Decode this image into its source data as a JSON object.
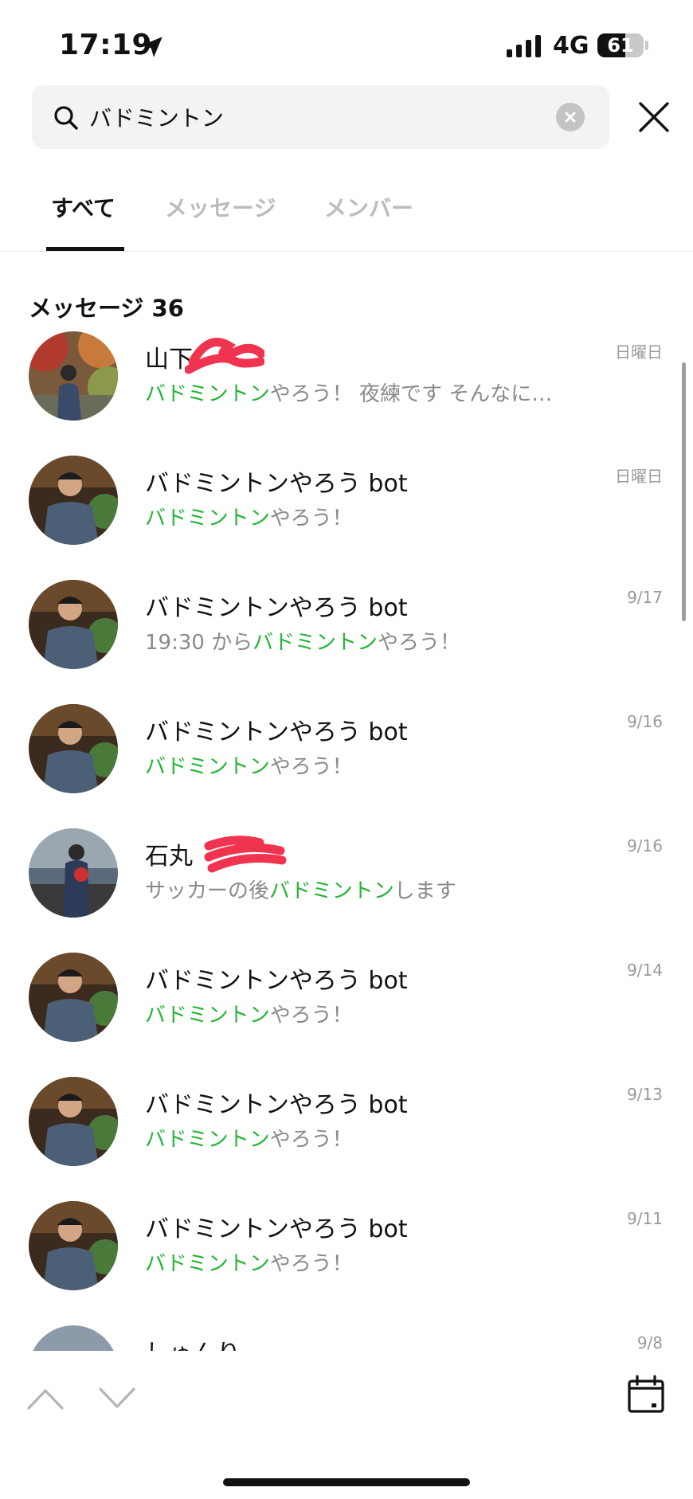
{
  "status_bar": {
    "time": "17:19",
    "network": "4G",
    "battery": "61",
    "battery_level": 0.61
  },
  "search": {
    "query": "バドミントン",
    "placeholder": ""
  },
  "tabs": [
    {
      "label": "すべて",
      "active": true
    },
    {
      "label": "メッセージ",
      "active": false
    },
    {
      "label": "メンバー",
      "active": false
    }
  ],
  "section": {
    "title": "メッセージ 36"
  },
  "results": [
    {
      "name": "山下",
      "msg_pre": "",
      "msg_hl": "バドミントン",
      "msg_post": "やろう！ 夜練です そんなに…",
      "date": "日曜日"
    },
    {
      "name": "バドミントンやろう bot",
      "msg_pre": "",
      "msg_hl": "バドミントン",
      "msg_post": "やろう！",
      "date": "日曜日"
    },
    {
      "name": "バドミントンやろう bot",
      "msg_pre": "19:30 から",
      "msg_hl": "バドミントン",
      "msg_post": "やろう！",
      "date": "9/17"
    },
    {
      "name": "バドミントンやろう bot",
      "msg_pre": "",
      "msg_hl": "バドミントン",
      "msg_post": "やろう！",
      "date": "9/16"
    },
    {
      "name": "石丸",
      "msg_pre": "サッカーの後",
      "msg_hl": "バドミントン",
      "msg_post": "します",
      "date": "9/16"
    },
    {
      "name": "バドミントンやろう bot",
      "msg_pre": "",
      "msg_hl": "バドミントン",
      "msg_post": "やろう！",
      "date": "9/14"
    },
    {
      "name": "バドミントンやろう bot",
      "msg_pre": "",
      "msg_hl": "バドミントン",
      "msg_post": "やろう！",
      "date": "9/13"
    },
    {
      "name": "バドミントンやろう bot",
      "msg_pre": "",
      "msg_hl": "バドミントン",
      "msg_post": "やろう！",
      "date": "9/11"
    },
    {
      "name": "しゅんり",
      "msg_pre": "",
      "msg_hl": "",
      "msg_post": "",
      "date": "9/8"
    }
  ],
  "colors": {
    "highlight": "#25b533",
    "redaction": "#f0344f",
    "secondary_text": "#8a8a8a"
  },
  "icons": {
    "location": "location-arrow-icon",
    "signal": "cellular-signal-icon",
    "search": "search-icon",
    "clear": "clear-x-icon",
    "close": "close-icon",
    "up": "chevron-up-icon",
    "down": "chevron-down-icon",
    "calendar": "calendar-icon"
  }
}
